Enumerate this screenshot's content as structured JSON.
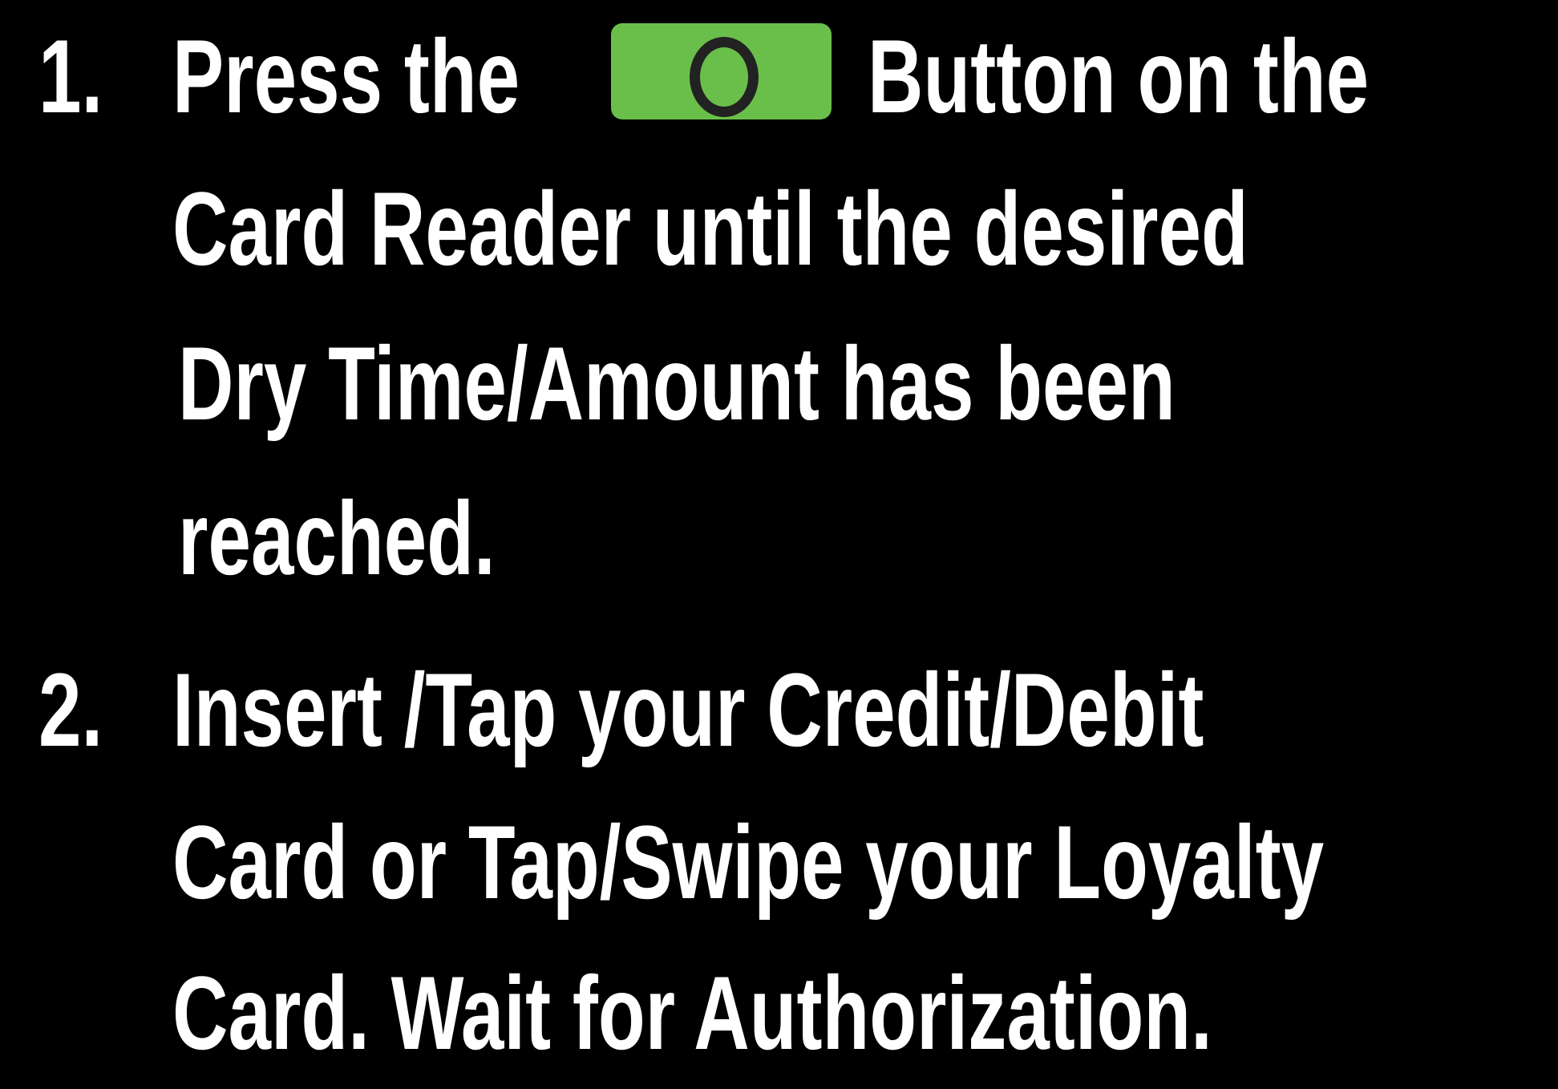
{
  "steps": [
    {
      "number": "1.",
      "line1_before": "Press the",
      "line1_after": "Button on the",
      "lines": [
        "Card Reader until the desired",
        "Dry Time/Amount has been",
        "reached."
      ]
    },
    {
      "number": "2.",
      "lines": [
        "Insert /Tap your Credit/Debit",
        "Card or Tap/Swipe your Loyalty",
        "Card.  Wait for Authorization."
      ]
    }
  ],
  "icons": {
    "start_button": "green-start-button-icon",
    "start_button_color": "#6abf4b",
    "ring_color": "#222222"
  }
}
